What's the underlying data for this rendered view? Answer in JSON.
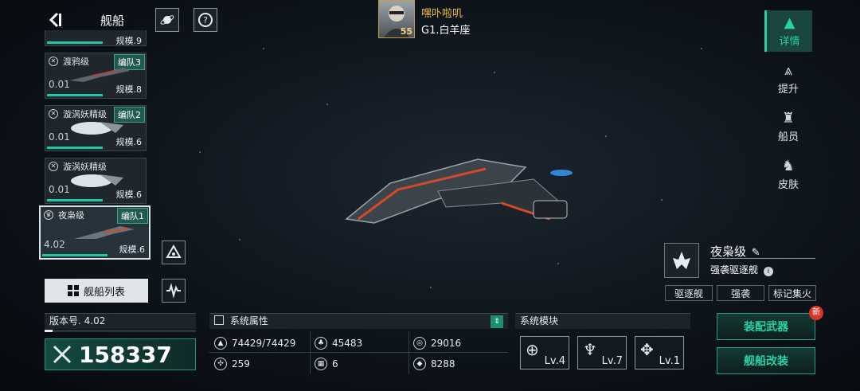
{
  "header": {
    "title": "舰船",
    "commander_name": "嘿卟啦叽",
    "commander_level": "55",
    "commander_location": "G1.白羊座"
  },
  "ship_cards": [
    {
      "name": "渡鸦级",
      "fleet": "编队3",
      "pct": "0.01",
      "scale": "规模.8",
      "fill": 0.55
    },
    {
      "name": "漩涡妖精级",
      "fleet": "编队2",
      "pct": "0.01",
      "scale": "规模.6",
      "fill": 0.55
    },
    {
      "name": "漩涡妖精级",
      "fleet": "",
      "pct": "0.01",
      "scale": "规模.6",
      "fill": 0.55
    },
    {
      "name": "夜枭级",
      "fleet": "编队1",
      "pct": "4.02",
      "scale": "规模.6",
      "fill": 0.65
    }
  ],
  "top_card_partial": "规模.9",
  "ship_list_label": "舰船列表",
  "right_nav": [
    {
      "label": "详情",
      "icon": "details-icon",
      "active": true
    },
    {
      "label": "提升",
      "icon": "upgrade-icon",
      "active": false
    },
    {
      "label": "船员",
      "icon": "crew-icon",
      "active": false
    },
    {
      "label": "皮肤",
      "icon": "skin-icon",
      "active": false
    }
  ],
  "ship_info": {
    "name": "夜枭级",
    "class": "强袭驱逐舰",
    "tags": [
      "驱逐舰",
      "强袭",
      "标记集火"
    ]
  },
  "version": {
    "label": "版本号. 4.02",
    "power": "158337"
  },
  "system_attributes": {
    "title": "系统属性",
    "values": [
      "74429/74429",
      "45483",
      "29016",
      "259",
      "6",
      "8288"
    ]
  },
  "system_modules": {
    "title": "系统模块",
    "modules": [
      "Lv.4",
      "Lv.7",
      "Lv.1"
    ]
  },
  "actions": {
    "equip_weapons": "装配武器",
    "ship_modify": "舰船改装",
    "new_badge": "新"
  },
  "colors": {
    "accent": "#2ad0a8",
    "gold": "#f0c040",
    "badge": "#d8352a"
  }
}
